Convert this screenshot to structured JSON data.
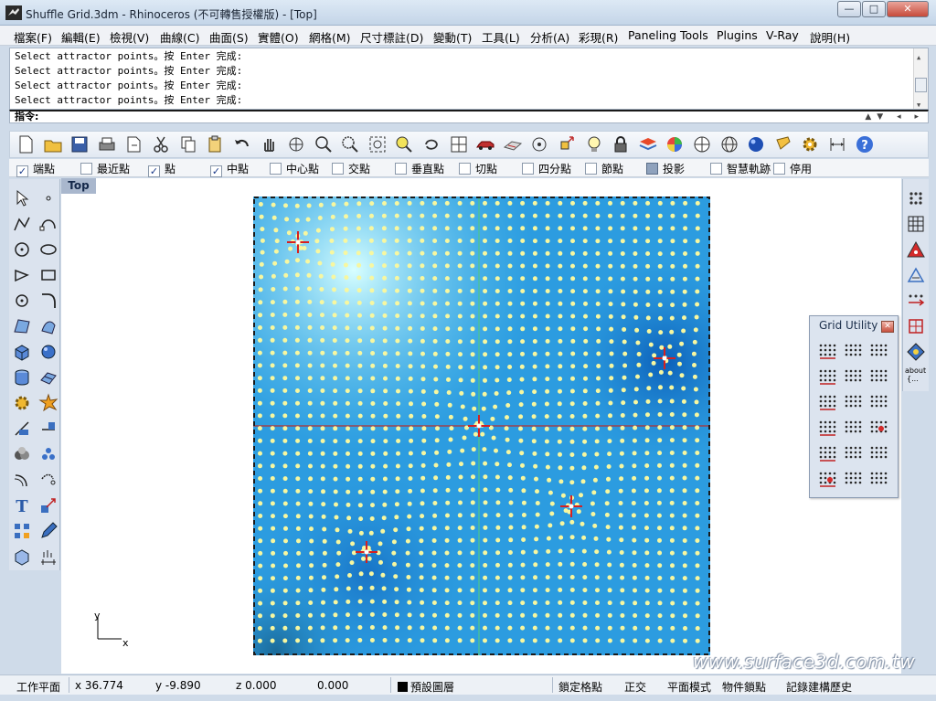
{
  "window": {
    "title": "Shuffle Grid.3dm - Rhinoceros (不可轉售授權版) - [Top]",
    "controls": {
      "minimize": "—",
      "maximize": "□",
      "close": "✕"
    }
  },
  "menu": [
    "檔案(F)",
    "編輯(E)",
    "檢視(V)",
    "曲線(C)",
    "曲面(S)",
    "實體(O)",
    "網格(M)",
    "尺寸標註(D)",
    "變動(T)",
    "工具(L)",
    "分析(A)",
    "彩現(R)",
    "Paneling Tools",
    "Plugins",
    "V-Ray",
    "說明(H)"
  ],
  "command_history": [
    "Select attractor points。按 Enter 完成:",
    "Select attractor points。按 Enter 完成:",
    "Select attractor points。按 Enter 完成:",
    "Select attractor points。按 Enter 完成:"
  ],
  "command_prompt": "指令:",
  "standard_toolbar": [
    "new-file-icon",
    "open-file-icon",
    "save-icon",
    "print-icon",
    "import-icon",
    "cut-icon",
    "copy-icon",
    "paste-icon",
    "undo-icon",
    "pan-hand-icon",
    "rotate-view-icon",
    "zoom-window-icon",
    "zoom-dynamic-icon",
    "zoom-extents-icon",
    "zoom-selected-icon",
    "undo-view-icon",
    "four-viewports-icon",
    "car-icon",
    "cplane-icon",
    "point-icon",
    "gumball-icon",
    "light-bulb-icon",
    "lock-icon",
    "layer-icon",
    "color-wheel-icon",
    "render-icon",
    "mesh-sphere-icon",
    "material-ball-icon",
    "flashlight-icon",
    "options-gear-icon",
    "dimension-icon",
    "help-icon"
  ],
  "osnaps": [
    {
      "label": "端點",
      "checked": true
    },
    {
      "label": "最近點",
      "checked": false
    },
    {
      "label": "點",
      "checked": true
    },
    {
      "label": "中點",
      "checked": true
    },
    {
      "label": "中心點",
      "checked": false
    },
    {
      "label": "交點",
      "checked": false
    },
    {
      "label": "垂直點",
      "checked": false
    },
    {
      "label": "切點",
      "checked": false
    },
    {
      "label": "四分點",
      "checked": false
    },
    {
      "label": "節點",
      "checked": false
    },
    {
      "label": "投影",
      "checked": false
    },
    {
      "label": "智慧軌跡",
      "checked": false
    },
    {
      "label": "停用",
      "checked": false
    }
  ],
  "viewport": {
    "name": "Top",
    "axis_x": "x",
    "axis_y": "y"
  },
  "grid_utility": {
    "title": "Grid Utility",
    "close": "✕"
  },
  "right_toolbar": {
    "about_label": "about",
    "about_sub": "{..."
  },
  "watermark": "www.surface3d.com.tw",
  "status": {
    "cplane": "工作平面",
    "x": "x 36.774",
    "y": "y -9.890",
    "z": "z 0.000",
    "extra": "0.000",
    "layer": "預設圖層",
    "snap": "鎖定格點",
    "ortho": "正交",
    "planar": "平面模式",
    "osnap": "物件鎖點",
    "history": "記錄建構歷史"
  },
  "colors": {
    "viewport_field_light": "#b8f5ff",
    "viewport_field_dark": "#1a8ad6",
    "grid_point": "#f7f7a0",
    "attractor": "#d62020"
  }
}
